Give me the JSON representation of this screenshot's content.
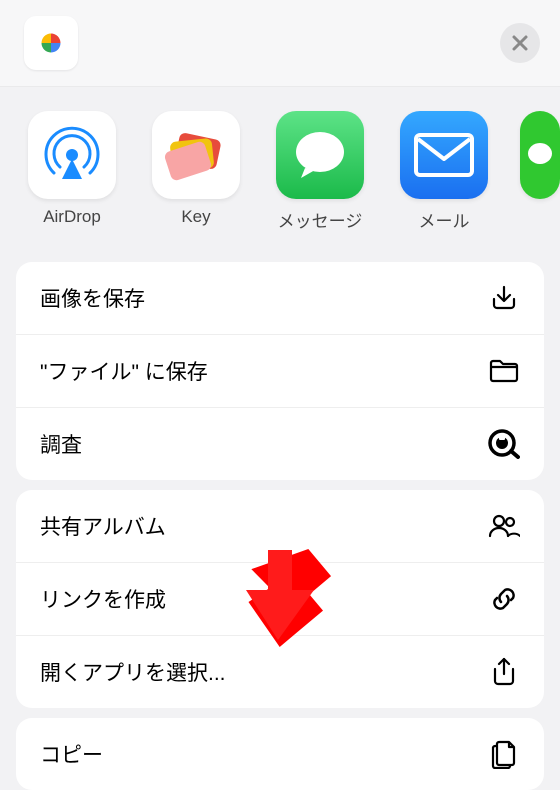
{
  "header": {
    "source_app": "google-photos"
  },
  "apps": [
    {
      "name": "airdrop",
      "label": "AirDrop"
    },
    {
      "name": "key",
      "label": "Key"
    },
    {
      "name": "messages",
      "label": "メッセージ"
    },
    {
      "name": "mail",
      "label": "メール"
    },
    {
      "name": "line",
      "label": ""
    }
  ],
  "groups": [
    {
      "items": [
        {
          "label": "画像を保存",
          "icon": "download-icon"
        },
        {
          "label": "\"ファイル\" に保存",
          "icon": "folder-icon"
        },
        {
          "label": "調査",
          "icon": "inspect-icon"
        }
      ]
    },
    {
      "items": [
        {
          "label": "共有アルバム",
          "icon": "people-icon"
        },
        {
          "label": "リンクを作成",
          "icon": "link-icon"
        },
        {
          "label": "開くアプリを選択...",
          "icon": "share-icon"
        }
      ]
    },
    {
      "items": [
        {
          "label": "コピー",
          "icon": "copy-icon"
        }
      ]
    }
  ]
}
